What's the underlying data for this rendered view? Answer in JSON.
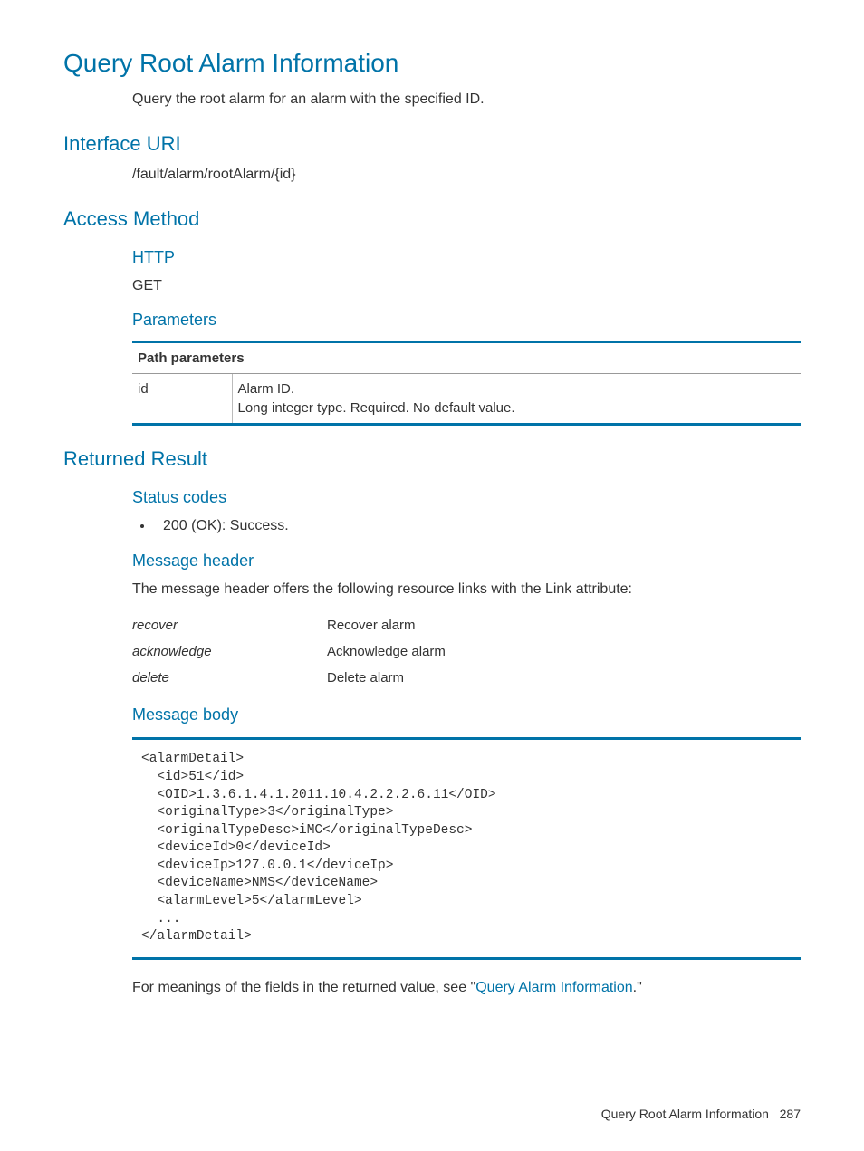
{
  "title": "Query Root Alarm Information",
  "intro": "Query the root alarm for an alarm with the specified ID.",
  "sections": {
    "interface_uri": {
      "heading": "Interface URI",
      "value": "/fault/alarm/rootAlarm/{id}"
    },
    "access_method": {
      "heading": "Access Method",
      "http_label": "HTTP",
      "http_value": "GET",
      "parameters_label": "Parameters",
      "table_header": "Path parameters",
      "param_name": "id",
      "param_desc_line1": "Alarm ID.",
      "param_desc_line2": "Long integer type. Required. No default value."
    },
    "returned_result": {
      "heading": "Returned Result",
      "status_codes_label": "Status codes",
      "status_code_item": "200 (OK): Success.",
      "message_header_label": "Message header",
      "message_header_intro": "The message header offers the following resource links with the Link attribute:",
      "links": [
        {
          "name": "recover",
          "desc": "Recover alarm"
        },
        {
          "name": "acknowledge",
          "desc": "Acknowledge alarm"
        },
        {
          "name": "delete",
          "desc": "Delete alarm"
        }
      ],
      "message_body_label": "Message body",
      "code": "<alarmDetail>\n  <id>51</id>\n  <OID>1.3.6.1.4.1.2011.10.4.2.2.2.6.11</OID>\n  <originalType>3</originalType>\n  <originalTypeDesc>iMC</originalTypeDesc>\n  <deviceId>0</deviceId>\n  <deviceIp>127.0.0.1</deviceIp>\n  <deviceName>NMS</deviceName>\n  <alarmLevel>5</alarmLevel>\n  ...\n</alarmDetail>",
      "footnote_prefix": "For meanings of the fields in the returned value, see \"",
      "footnote_link": "Query Alarm Information",
      "footnote_suffix": ".\""
    }
  },
  "footer": {
    "title": "Query Root Alarm Information",
    "page": "287"
  }
}
